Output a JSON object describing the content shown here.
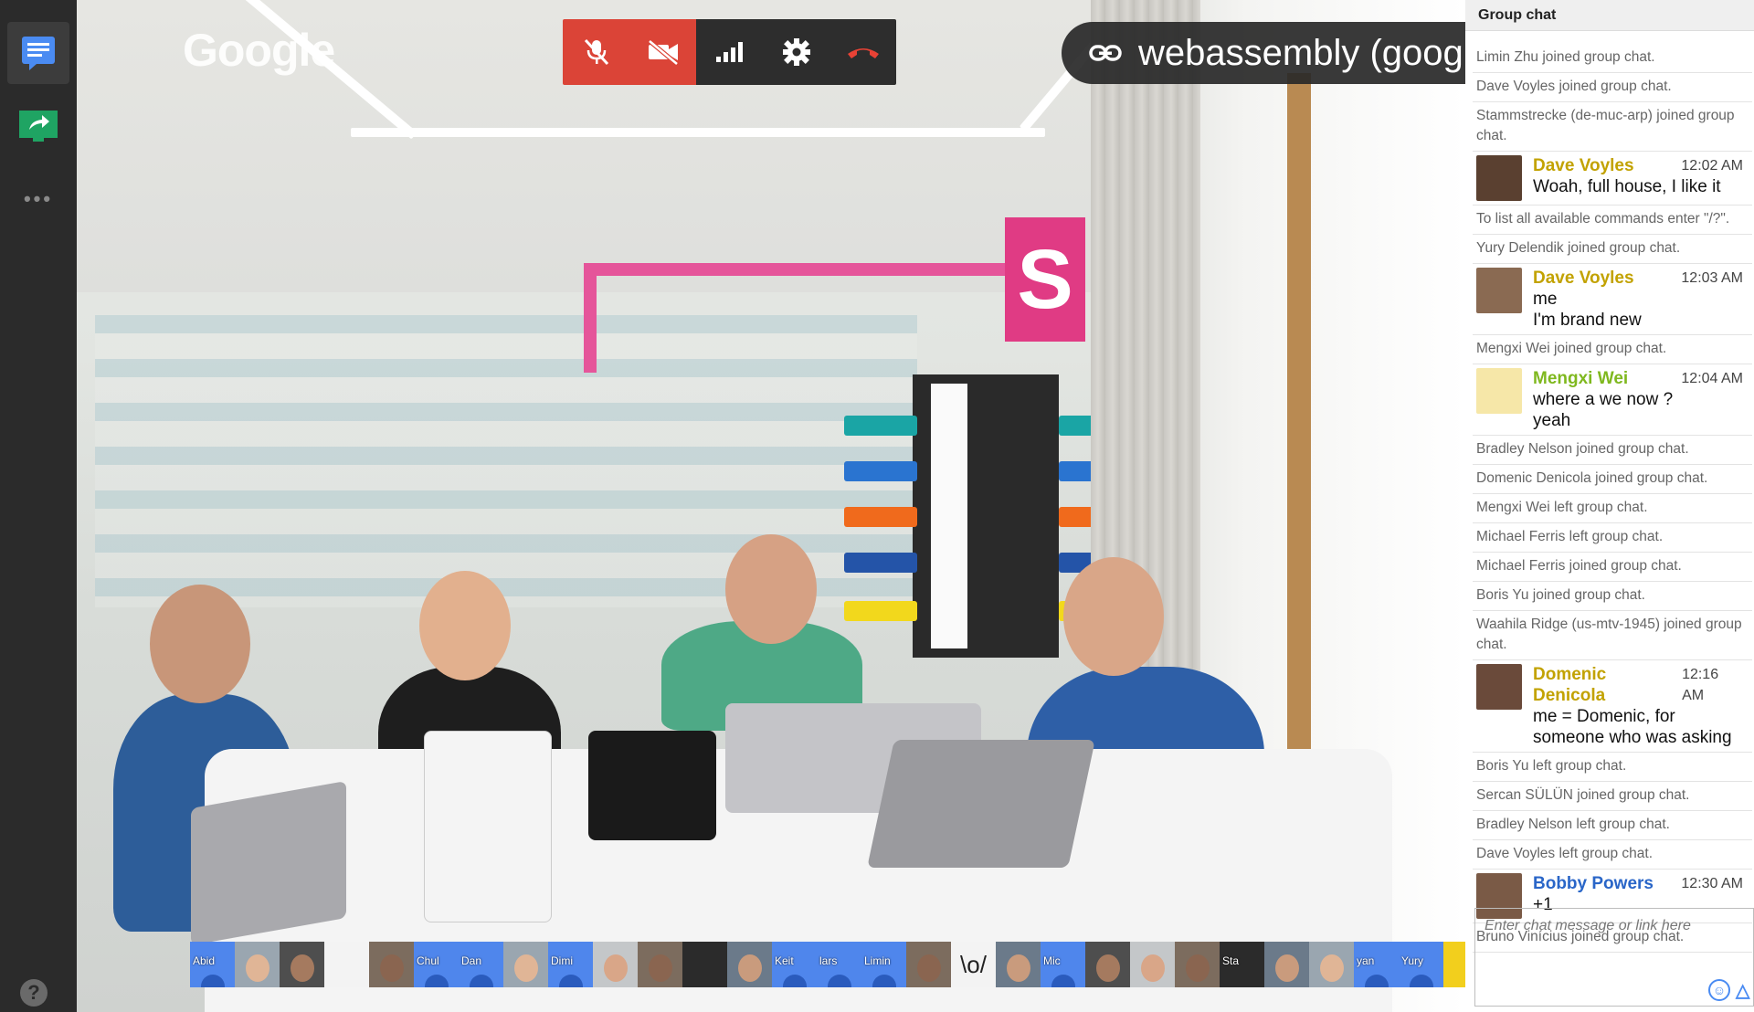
{
  "branding": {
    "logo": "Google"
  },
  "call": {
    "link_text": "webassembly (google...",
    "controls": [
      "mic-off-icon",
      "video-off-icon",
      "signal-icon",
      "settings-icon",
      "hang-up-icon"
    ],
    "mute_color": "#db4437"
  },
  "rail": {
    "items": [
      "chat-icon",
      "screenshare-icon",
      "more-icon"
    ],
    "help": "?"
  },
  "filmstrip": [
    {
      "label": "Abid",
      "type": "blue"
    },
    {
      "label": "",
      "type": "face"
    },
    {
      "label": "",
      "type": "face"
    },
    {
      "label": "",
      "type": "text"
    },
    {
      "label": "",
      "type": "face"
    },
    {
      "label": "Chul",
      "type": "blue"
    },
    {
      "label": "Dan",
      "type": "blue"
    },
    {
      "label": "",
      "type": "face"
    },
    {
      "label": "Dimi",
      "type": "blue"
    },
    {
      "label": "",
      "type": "face"
    },
    {
      "label": "",
      "type": "face"
    },
    {
      "label": "",
      "type": "dark"
    },
    {
      "label": "",
      "type": "face"
    },
    {
      "label": "Keit",
      "type": "blue"
    },
    {
      "label": "lars",
      "type": "blue"
    },
    {
      "label": "Limin",
      "type": "blue"
    },
    {
      "label": "",
      "type": "face"
    },
    {
      "label": "\\o/",
      "type": "text"
    },
    {
      "label": "",
      "type": "face"
    },
    {
      "label": "Mic",
      "type": "blue"
    },
    {
      "label": "",
      "type": "face"
    },
    {
      "label": "",
      "type": "face"
    },
    {
      "label": "",
      "type": "face"
    },
    {
      "label": "Sta",
      "type": "dark"
    },
    {
      "label": "",
      "type": "face"
    },
    {
      "label": "",
      "type": "face"
    },
    {
      "label": "yan",
      "type": "blue"
    },
    {
      "label": "Yury",
      "type": "blue"
    },
    {
      "label": "",
      "type": "yellow"
    },
    {
      "label": "",
      "type": "face"
    }
  ],
  "chat": {
    "title": "Group chat",
    "input_placeholder": "Enter chat message or link here",
    "entries": [
      {
        "kind": "sys",
        "text": "Limin Zhu joined group chat."
      },
      {
        "kind": "sys",
        "text": "Dave Voyles joined group chat."
      },
      {
        "kind": "sys",
        "text": "Stammstrecke (de-muc-arp) joined group chat."
      },
      {
        "kind": "msg",
        "name": "Dave Voyles",
        "time": "12:02 AM",
        "color": "#c2a200",
        "lines": [
          "Woah, full house, I like it"
        ]
      },
      {
        "kind": "sys",
        "text": "To list all available commands enter \"/?\"."
      },
      {
        "kind": "sys",
        "text": "Yury Delendik joined group chat."
      },
      {
        "kind": "msg",
        "name": "Dave Voyles",
        "time": "12:03 AM",
        "color": "#c2a200",
        "lines": [
          "me",
          "I'm brand new"
        ]
      },
      {
        "kind": "sys",
        "text": "Mengxi Wei joined group chat."
      },
      {
        "kind": "msg",
        "name": "Mengxi Wei",
        "time": "12:04 AM",
        "color": "#7fb81e",
        "lines": [
          "where a we now ?",
          "yeah"
        ]
      },
      {
        "kind": "sys",
        "text": "Bradley Nelson joined group chat."
      },
      {
        "kind": "sys",
        "text": "Domenic Denicola joined group chat."
      },
      {
        "kind": "sys",
        "text": "Mengxi Wei left group chat."
      },
      {
        "kind": "sys",
        "text": "Michael Ferris left group chat."
      },
      {
        "kind": "sys",
        "text": "Michael Ferris joined group chat."
      },
      {
        "kind": "sys",
        "text": "Boris Yu joined group chat."
      },
      {
        "kind": "sys",
        "text": "Waahila Ridge (us-mtv-1945) joined group chat."
      },
      {
        "kind": "msg",
        "name": "Domenic Denicola",
        "time": "12:16 AM",
        "color": "#c2a200",
        "lines": [
          "me = Domenic, for",
          "someone who was asking"
        ]
      },
      {
        "kind": "sys",
        "text": "Boris Yu left group chat."
      },
      {
        "kind": "sys",
        "text": "Sercan SÜLÜN joined group chat."
      },
      {
        "kind": "sys",
        "text": "Bradley Nelson left group chat."
      },
      {
        "kind": "sys",
        "text": "Dave Voyles left group chat."
      },
      {
        "kind": "msg",
        "name": "Bobby Powers",
        "time": "12:30 AM",
        "color": "#2a66c8",
        "lines": [
          "+1"
        ]
      },
      {
        "kind": "sys",
        "text": "Bruno Vinícius joined group chat."
      }
    ]
  }
}
